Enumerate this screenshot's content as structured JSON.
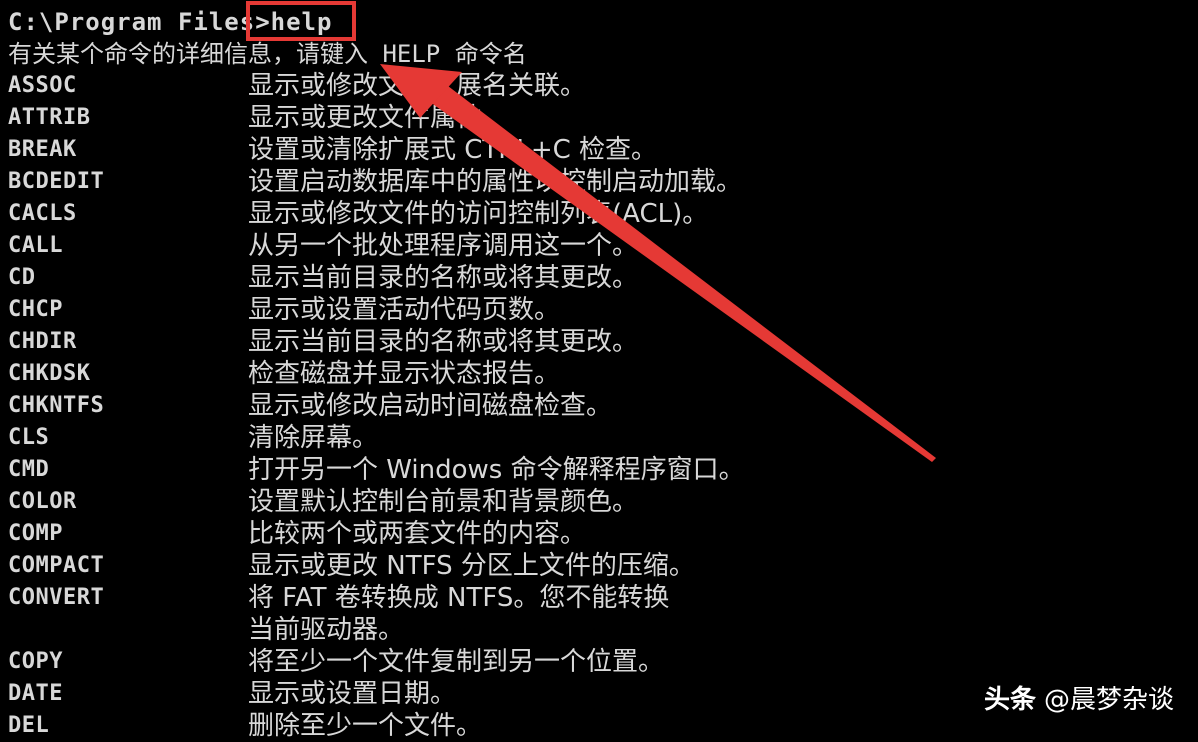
{
  "console": {
    "prompt_path": "C:\\Program Files>",
    "command": "help",
    "intro": "有关某个命令的详细信息，请键入 HELP 命令名",
    "commands": [
      {
        "name": "ASSOC",
        "desc": "显示或修改文件扩展名关联。"
      },
      {
        "name": "ATTRIB",
        "desc": "显示或更改文件属性。"
      },
      {
        "name": "BREAK",
        "desc": "设置或清除扩展式 CTRL+C 检查。"
      },
      {
        "name": "BCDEDIT",
        "desc": "设置启动数据库中的属性以控制启动加载。"
      },
      {
        "name": "CACLS",
        "desc": "显示或修改文件的访问控制列表(ACL)。"
      },
      {
        "name": "CALL",
        "desc": "从另一个批处理程序调用这一个。"
      },
      {
        "name": "CD",
        "desc": "显示当前目录的名称或将其更改。"
      },
      {
        "name": "CHCP",
        "desc": "显示或设置活动代码页数。"
      },
      {
        "name": "CHDIR",
        "desc": "显示当前目录的名称或将其更改。"
      },
      {
        "name": "CHKDSK",
        "desc": "检查磁盘并显示状态报告。"
      },
      {
        "name": "CHKNTFS",
        "desc": "显示或修改启动时间磁盘检查。"
      },
      {
        "name": "CLS",
        "desc": "清除屏幕。"
      },
      {
        "name": "CMD",
        "desc": "打开另一个 Windows 命令解释程序窗口。"
      },
      {
        "name": "COLOR",
        "desc": "设置默认控制台前景和背景颜色。"
      },
      {
        "name": "COMP",
        "desc": "比较两个或两套文件的内容。"
      },
      {
        "name": "COMPACT",
        "desc": "显示或更改 NTFS 分区上文件的压缩。"
      },
      {
        "name": "CONVERT",
        "desc": "将 FAT 卷转换成 NTFS。您不能转换"
      },
      {
        "name": "",
        "desc": "当前驱动器。"
      },
      {
        "name": "COPY",
        "desc": "将至少一个文件复制到另一个位置。"
      },
      {
        "name": "DATE",
        "desc": "显示或设置日期。"
      },
      {
        "name": "DEL",
        "desc": "删除至少一个文件。"
      }
    ]
  },
  "annotation": {
    "highlight_color": "#e53935",
    "arrow_color": "#e53935"
  },
  "watermark": {
    "brand": "头条",
    "author": "@晨梦杂谈"
  }
}
